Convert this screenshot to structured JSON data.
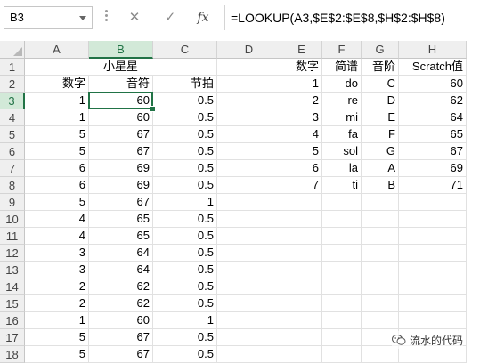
{
  "formula_bar": {
    "name_box": "B3",
    "cancel_glyph": "✕",
    "enter_glyph": "✓",
    "fx_label": "fx",
    "formula": "=LOOKUP(A3,$E$2:$E$8,$H$2:$H$8)"
  },
  "columns": [
    "A",
    "B",
    "C",
    "D",
    "E",
    "F",
    "G",
    "H"
  ],
  "selected_column": "B",
  "selected_row": "3",
  "selected_cell": "B3",
  "rows": [
    {
      "n": "1",
      "A": "",
      "B": "小星星",
      "C": "",
      "D": "",
      "E": "数字",
      "F": "简谱",
      "G": "音阶",
      "H": "Scratch值"
    },
    {
      "n": "2",
      "A": "数字",
      "B": "音符",
      "C": "节拍",
      "D": "",
      "E": "1",
      "F": "do",
      "G": "C",
      "H": "60"
    },
    {
      "n": "3",
      "A": "1",
      "B": "60",
      "C": "0.5",
      "D": "",
      "E": "2",
      "F": "re",
      "G": "D",
      "H": "62"
    },
    {
      "n": "4",
      "A": "1",
      "B": "60",
      "C": "0.5",
      "D": "",
      "E": "3",
      "F": "mi",
      "G": "E",
      "H": "64"
    },
    {
      "n": "5",
      "A": "5",
      "B": "67",
      "C": "0.5",
      "D": "",
      "E": "4",
      "F": "fa",
      "G": "F",
      "H": "65"
    },
    {
      "n": "6",
      "A": "5",
      "B": "67",
      "C": "0.5",
      "D": "",
      "E": "5",
      "F": "sol",
      "G": "G",
      "H": "67"
    },
    {
      "n": "7",
      "A": "6",
      "B": "69",
      "C": "0.5",
      "D": "",
      "E": "6",
      "F": "la",
      "G": "A",
      "H": "69"
    },
    {
      "n": "8",
      "A": "6",
      "B": "69",
      "C": "0.5",
      "D": "",
      "E": "7",
      "F": "ti",
      "G": "B",
      "H": "71"
    },
    {
      "n": "9",
      "A": "5",
      "B": "67",
      "C": "1",
      "D": "",
      "E": "",
      "F": "",
      "G": "",
      "H": ""
    },
    {
      "n": "10",
      "A": "4",
      "B": "65",
      "C": "0.5",
      "D": "",
      "E": "",
      "F": "",
      "G": "",
      "H": ""
    },
    {
      "n": "11",
      "A": "4",
      "B": "65",
      "C": "0.5",
      "D": "",
      "E": "",
      "F": "",
      "G": "",
      "H": ""
    },
    {
      "n": "12",
      "A": "3",
      "B": "64",
      "C": "0.5",
      "D": "",
      "E": "",
      "F": "",
      "G": "",
      "H": ""
    },
    {
      "n": "13",
      "A": "3",
      "B": "64",
      "C": "0.5",
      "D": "",
      "E": "",
      "F": "",
      "G": "",
      "H": ""
    },
    {
      "n": "14",
      "A": "2",
      "B": "62",
      "C": "0.5",
      "D": "",
      "E": "",
      "F": "",
      "G": "",
      "H": ""
    },
    {
      "n": "15",
      "A": "2",
      "B": "62",
      "C": "0.5",
      "D": "",
      "E": "",
      "F": "",
      "G": "",
      "H": ""
    },
    {
      "n": "16",
      "A": "1",
      "B": "60",
      "C": "1",
      "D": "",
      "E": "",
      "F": "",
      "G": "",
      "H": ""
    },
    {
      "n": "17",
      "A": "5",
      "B": "67",
      "C": "0.5",
      "D": "",
      "E": "",
      "F": "",
      "G": "",
      "H": ""
    },
    {
      "n": "18",
      "A": "5",
      "B": "67",
      "C": "0.5",
      "D": "",
      "E": "",
      "F": "",
      "G": "",
      "H": ""
    }
  ],
  "watermark": {
    "icon": "wechat-icon",
    "text": "流水的代码"
  },
  "colors": {
    "accent": "#217346",
    "header_bg": "#efefef",
    "selected_header_bg": "#d2e9d8"
  }
}
